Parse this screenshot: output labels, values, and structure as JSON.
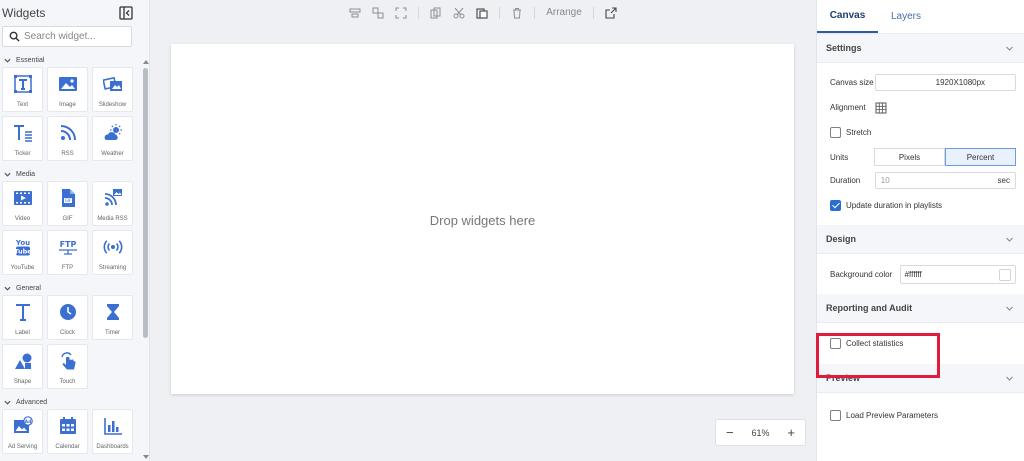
{
  "left_panel": {
    "title": "Widgets",
    "search_placeholder": "Search widget...",
    "categories": [
      {
        "name": "Essential",
        "items": [
          {
            "label": "Text",
            "icon": "text-icon"
          },
          {
            "label": "Image",
            "icon": "image-icon"
          },
          {
            "label": "Slideshow",
            "icon": "slideshow-icon"
          },
          {
            "label": "Ticker",
            "icon": "ticker-icon"
          },
          {
            "label": "RSS",
            "icon": "rss-icon"
          },
          {
            "label": "Weather",
            "icon": "weather-icon"
          }
        ]
      },
      {
        "name": "Media",
        "items": [
          {
            "label": "Video",
            "icon": "video-icon"
          },
          {
            "label": "GIF",
            "icon": "gif-icon"
          },
          {
            "label": "Media RSS",
            "icon": "media-rss-icon"
          },
          {
            "label": "YouTube",
            "icon": "youtube-icon"
          },
          {
            "label": "FTP",
            "icon": "ftp-icon"
          },
          {
            "label": "Streaming",
            "icon": "streaming-icon"
          }
        ]
      },
      {
        "name": "General",
        "items": [
          {
            "label": "Label",
            "icon": "label-icon"
          },
          {
            "label": "Clock",
            "icon": "clock-icon"
          },
          {
            "label": "Timer",
            "icon": "timer-icon"
          },
          {
            "label": "Shape",
            "icon": "shape-icon"
          },
          {
            "label": "Touch",
            "icon": "touch-icon"
          }
        ]
      },
      {
        "name": "Advanced",
        "items": [
          {
            "label": "Ad Serving",
            "icon": "ad-serving-icon"
          },
          {
            "label": "Calendar",
            "icon": "calendar-icon"
          },
          {
            "label": "Dashboards",
            "icon": "dashboards-icon"
          }
        ]
      }
    ]
  },
  "toolbar": {
    "arrange_label": "Arrange"
  },
  "canvas": {
    "placeholder": "Drop widgets here"
  },
  "zoom": {
    "minus": "−",
    "value": "61%",
    "plus": "+"
  },
  "right_panel": {
    "tabs": [
      {
        "label": "Canvas",
        "active": true
      },
      {
        "label": "Layers",
        "active": false
      }
    ],
    "settings": {
      "title": "Settings",
      "canvas_size_label": "Canvas size",
      "canvas_size_value": "1920X1080px",
      "alignment_label": "Alignment",
      "stretch_label": "Stretch",
      "units_label": "Units",
      "units_options": [
        "Pixels",
        "Percent"
      ],
      "units_selected": "Percent",
      "duration_label": "Duration",
      "duration_value": "10",
      "duration_unit": "sec",
      "update_duration_label": "Update duration in playlists"
    },
    "design": {
      "title": "Design",
      "background_color_label": "Background color",
      "background_color_value": "#ffffff"
    },
    "reporting": {
      "title": "Reporting and Audit",
      "collect_statistics_label": "Collect statistics"
    },
    "preview": {
      "title": "Preview",
      "load_preview_label": "Load Preview Parameters"
    }
  },
  "colors": {
    "accent": "#2a6ed4",
    "icon_blue": "#3b6fd1",
    "highlight_red": "#e01b3c"
  }
}
